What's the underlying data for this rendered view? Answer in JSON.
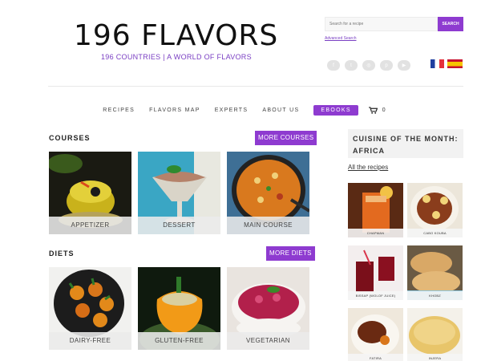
{
  "header": {
    "logo": "196 FLAVORS",
    "tagline": "196 COUNTRIES | A WORLD OF FLAVORS",
    "search_placeholder": "Search for a recipe",
    "search_button": "SEARCH",
    "advanced_search": "Advanced Search",
    "social_icons": [
      "facebook-icon",
      "twitter-icon",
      "instagram-icon",
      "pinterest-icon",
      "youtube-icon"
    ],
    "languages": [
      "fr",
      "es"
    ]
  },
  "nav": {
    "items": [
      "RECIPES",
      "FLAVORS MAP",
      "EXPERTS",
      "ABOUT US",
      "EBOOKS"
    ],
    "active": "EBOOKS",
    "cart_count": "0"
  },
  "courses": {
    "title": "COURSES",
    "more": "MORE COURSES",
    "cards": [
      "APPETIZER",
      "DESSERT",
      "MAIN COURSE"
    ]
  },
  "diets": {
    "title": "DIETS",
    "more": "MORE DIETS",
    "cards": [
      "DAIRY-FREE",
      "GLUTEN-FREE",
      "VEGETARIAN"
    ]
  },
  "sidebar": {
    "title": "CUISINE OF THE MONTH: AFRICA",
    "all_recipes": "All the recipes",
    "items": [
      "CHAPMAN",
      "CABO KOUBA",
      "BISSAP (WOLOF JUICE)",
      "KHOBZ",
      "FATIRA",
      "INJERA"
    ]
  },
  "colors": {
    "accent": "#8e3bd0",
    "tagline": "#7a3fc3"
  }
}
